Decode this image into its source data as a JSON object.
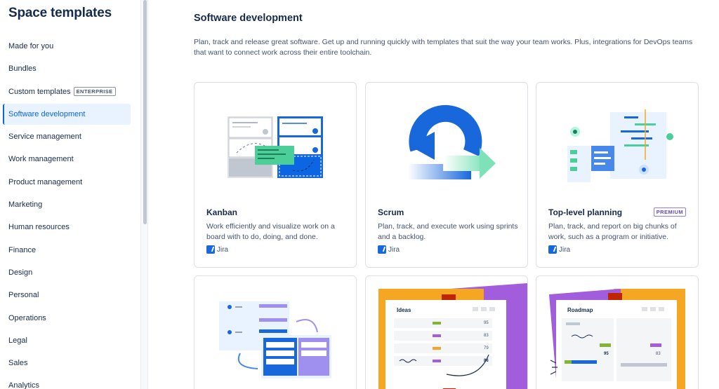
{
  "sidebar": {
    "title": "Space templates",
    "items": [
      {
        "label": "Made for you"
      },
      {
        "label": "Bundles"
      },
      {
        "label": "Custom templates",
        "badge": "ENTERPRISE"
      },
      {
        "label": "Software development",
        "selected": true
      },
      {
        "label": "Service management"
      },
      {
        "label": "Work management"
      },
      {
        "label": "Product management"
      },
      {
        "label": "Marketing"
      },
      {
        "label": "Human resources"
      },
      {
        "label": "Finance"
      },
      {
        "label": "Design"
      },
      {
        "label": "Personal"
      },
      {
        "label": "Operations"
      },
      {
        "label": "Legal"
      },
      {
        "label": "Sales"
      },
      {
        "label": "Analytics"
      }
    ]
  },
  "main": {
    "title": "Software development",
    "description": "Plan, track and release great software. Get up and running quickly with templates that suit the way your team works. Plus, integrations for DevOps teams that want to connect work across their entire toolchain.",
    "cards": [
      {
        "title": "Kanban",
        "description": "Work efficiently and visualize work on a board with to do, doing, and done.",
        "product": "Jira",
        "illustration": "kanban-illustration"
      },
      {
        "title": "Scrum",
        "description": "Plan, track, and execute work using sprints and a backlog.",
        "product": "Jira",
        "illustration": "scrum-illustration"
      },
      {
        "title": "Top-level planning",
        "badge": "PREMIUM",
        "description": "Plan, track, and report on big chunks of work, such as a program or initiative.",
        "product": "Jira",
        "illustration": "planning-illustration"
      },
      {
        "illustration": "workflow-illustration"
      },
      {
        "illustration": "ideas-illustration",
        "illustration_title": "Ideas",
        "illustration_values": [
          "95",
          "83",
          "79",
          "86"
        ]
      },
      {
        "illustration": "roadmap-illustration",
        "illustration_title": "Roadmap",
        "illustration_values": [
          "95",
          "83"
        ]
      }
    ]
  },
  "colors": {
    "accent": "#0c66e4",
    "selected_bg": "#e9f2ff",
    "jira_blue": "#1868db",
    "purple": "#a25ddc",
    "orange": "#f5a623"
  }
}
